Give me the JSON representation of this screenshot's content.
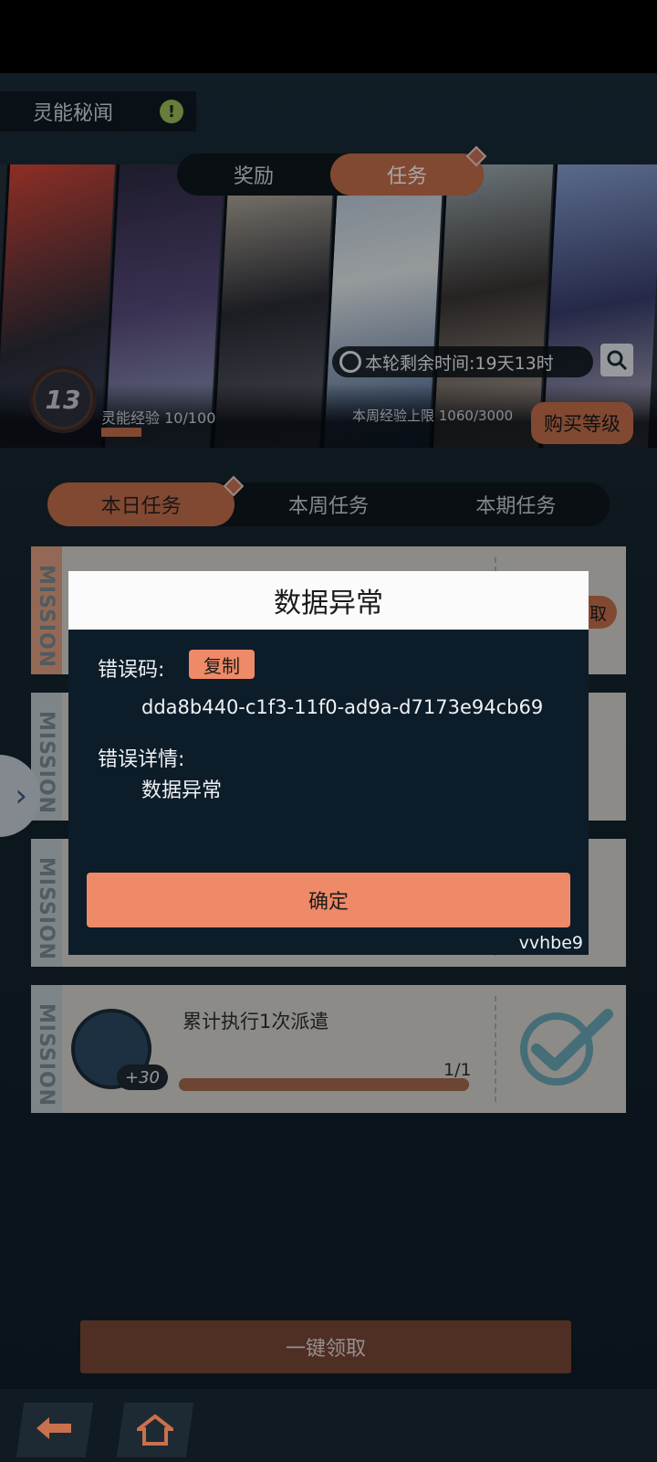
{
  "header": {
    "title": "灵能秘闻",
    "alert_glyph": "!"
  },
  "top_tabs": [
    {
      "label": "奖励",
      "active": false
    },
    {
      "label": "任务",
      "active": true
    }
  ],
  "banner": {
    "timer_text": "本轮剩余时间:19天13时",
    "level": "13",
    "exp_label": "灵能经验 10/100",
    "exp_progress": 0.1,
    "weekly_cap": "本周经验上限 1060/3000",
    "buy_level_label": "购买等级"
  },
  "sub_tabs": [
    {
      "label": "本日任务",
      "active": true
    },
    {
      "label": "本周任务",
      "active": false
    },
    {
      "label": "本期任务",
      "active": false
    }
  ],
  "cards": {
    "mission_text": "MISSION",
    "claim_stub_label": "取",
    "visible_task": {
      "title": "累计执行1次派遣",
      "count": "1/1",
      "progress": 1.0,
      "reward": "+30"
    }
  },
  "modal": {
    "title": "数据异常",
    "error_code_label": "错误码:",
    "copy_label": "复制",
    "error_code": "dda8b440-c1f3-11f0-ad9a-d7173e94cb69",
    "error_detail_label": "错误详情:",
    "error_detail": "数据异常",
    "confirm_label": "确定",
    "tag": "vvhbe9"
  },
  "footer": {
    "claim_all_label": "一键领取"
  },
  "colors": {
    "accent": "#c8714d",
    "modal_button": "#ee8a67",
    "modal_bg": "#0d1c29"
  },
  "icons": [
    "alert-icon",
    "clock-icon",
    "search-icon",
    "chevron-right-icon",
    "back-icon",
    "home-icon",
    "checkmark-badge-icon"
  ]
}
